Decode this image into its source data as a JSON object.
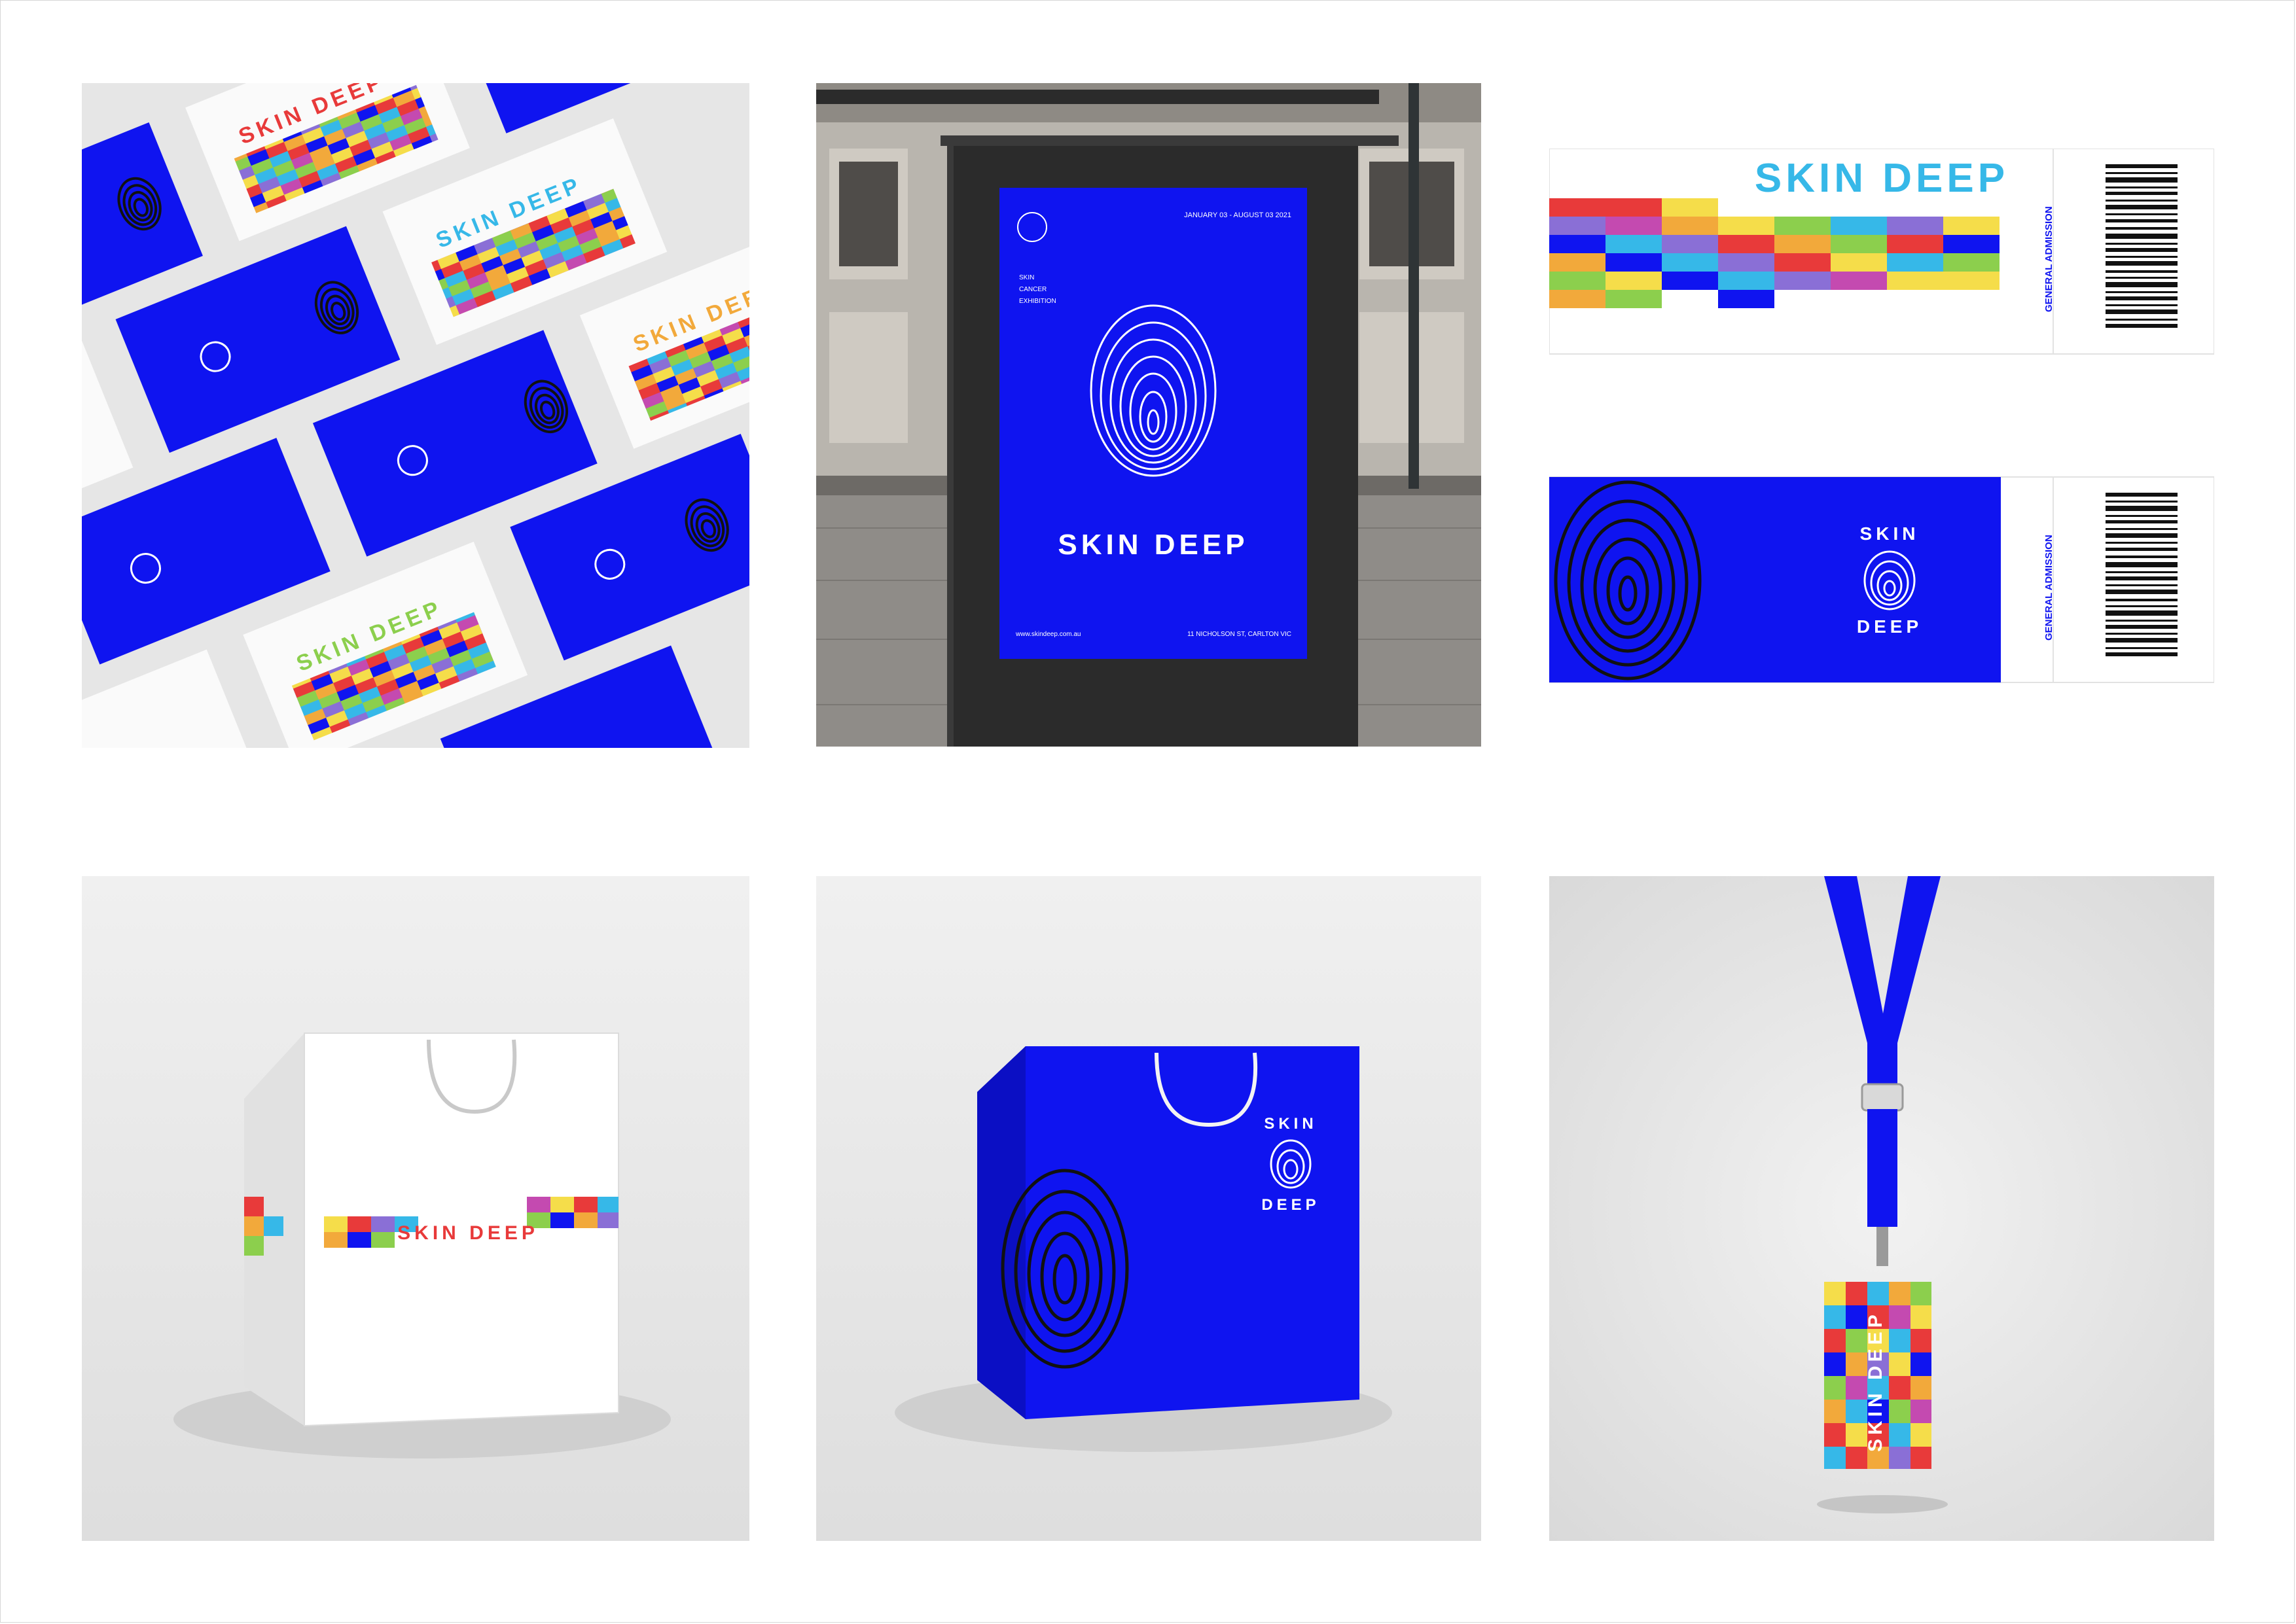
{
  "brand": {
    "name": "SKIN DEEP",
    "mark_top": "SKIN",
    "mark_bottom": "DEEP",
    "blue": "#0f14f0",
    "spectrum": [
      "#e83a3a",
      "#f2a93b",
      "#f5dd4a",
      "#8ccf4d",
      "#36b8e8",
      "#8a6fd6",
      "#0f14f0",
      "#c44ab0"
    ]
  },
  "poster": {
    "date_range": "JANUARY 03 - AUGUST 03 2021",
    "subtitle_1": "SKIN",
    "subtitle_2": "CANCER",
    "subtitle_3": "EXHIBITION",
    "title": "SKIN DEEP",
    "website": "www.skindeep.com.au",
    "address": "11 NICHOLSON ST, CARLTON VIC"
  },
  "tickets": {
    "admission_label": "GENERAL ADMISSION",
    "title": "SKIN DEEP"
  },
  "bags": {
    "white_bag_label": "SKIN DEEP"
  },
  "lanyard": {
    "card_label": "SKIN DEEP"
  }
}
